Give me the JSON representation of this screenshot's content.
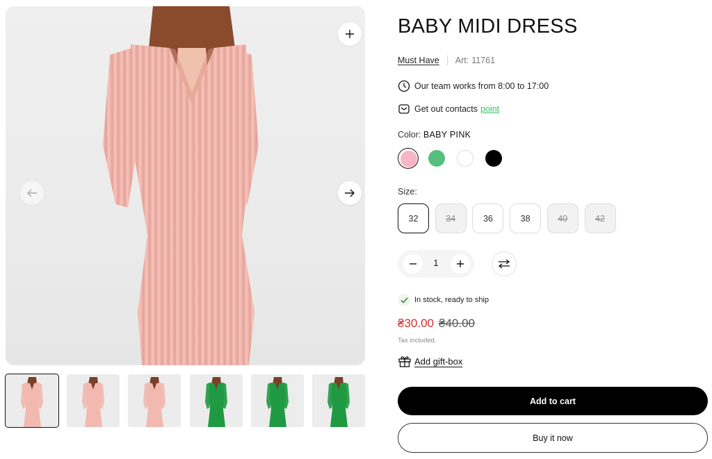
{
  "product": {
    "title": "BABY MIDI DRESS",
    "brand": "Must Have",
    "article_label": "Art:",
    "article_number": "11761",
    "hours_text": "Our team works from 8:00 to 17:00",
    "contacts_text": "Get out contacts",
    "contacts_link": "point"
  },
  "color": {
    "label": "Color:",
    "selected_name": "BABY PINK",
    "swatches": [
      {
        "name": "baby-pink",
        "hex": "#f7b6c8",
        "selected": true
      },
      {
        "name": "green",
        "hex": "#55c07e",
        "selected": false
      },
      {
        "name": "white",
        "hex": "#ffffff",
        "selected": false
      },
      {
        "name": "black",
        "hex": "#000000",
        "selected": false
      }
    ]
  },
  "size": {
    "label": "Size:",
    "options": [
      {
        "value": "32",
        "state": "selected"
      },
      {
        "value": "34",
        "state": "unavailable"
      },
      {
        "value": "36",
        "state": "available"
      },
      {
        "value": "38",
        "state": "available"
      },
      {
        "value": "40",
        "state": "unavailable"
      },
      {
        "value": "42",
        "state": "unavailable"
      }
    ]
  },
  "quantity": {
    "value": "1"
  },
  "stock": {
    "text": "In stock, ready to ship"
  },
  "price": {
    "sale": "₴30.00",
    "original": "₴40.00",
    "tax_note": "Tax included."
  },
  "gift": {
    "label": "Add gift-box"
  },
  "actions": {
    "add_to_cart": "Add to cart",
    "buy_now": "Buy it now"
  },
  "gallery": {
    "thumbnails": [
      {
        "dress_color": "#f1b9b0",
        "active": true
      },
      {
        "dress_color": "#f1b9b0",
        "active": false
      },
      {
        "dress_color": "#f1b9b0",
        "active": false
      },
      {
        "dress_color": "#1f9a43",
        "active": false
      },
      {
        "dress_color": "#1f9a43",
        "active": false
      },
      {
        "dress_color": "#1f9a43",
        "active": false
      }
    ]
  },
  "colors": {
    "accent_link": "#3cbf6a",
    "sale_price": "#d3302f",
    "primary_button": "#000000"
  }
}
